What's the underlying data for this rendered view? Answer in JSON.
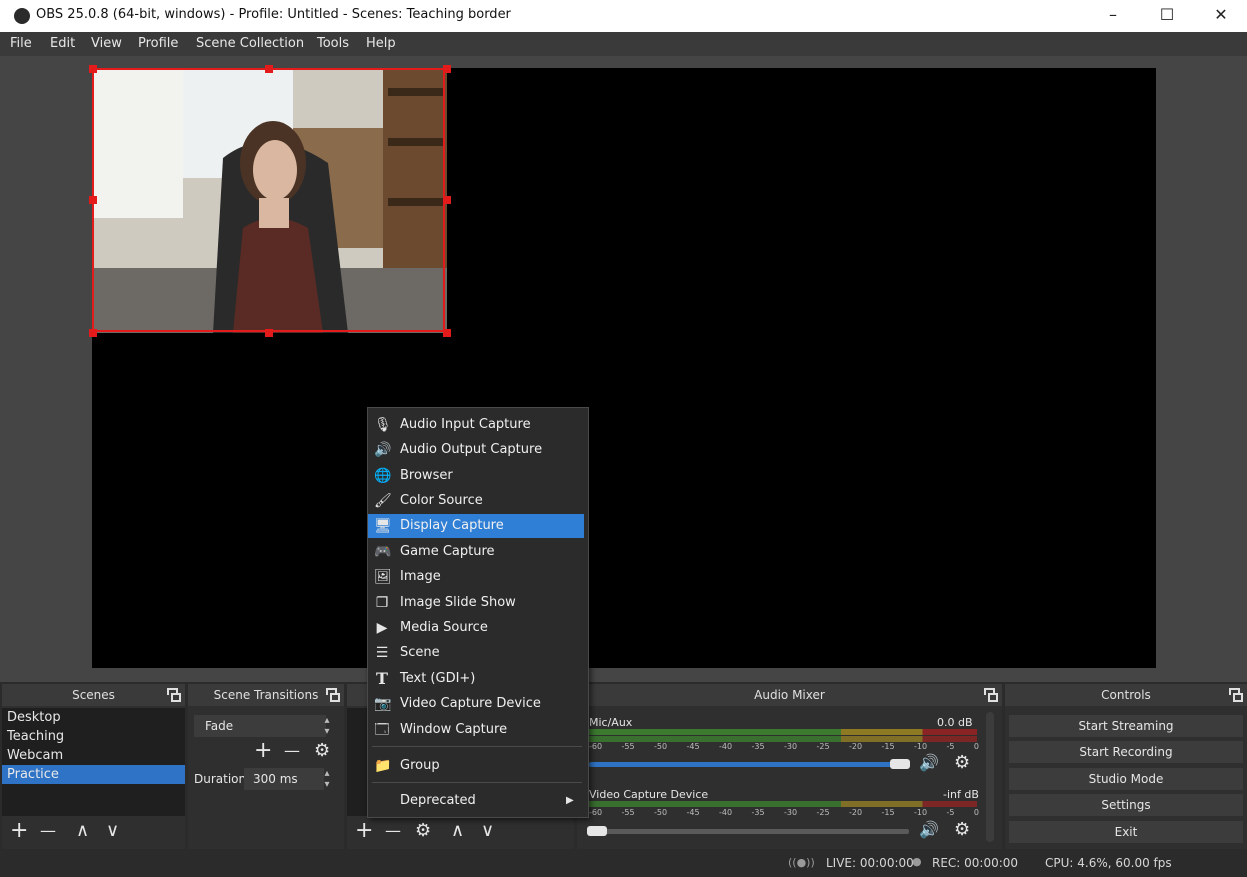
{
  "window": {
    "title": "OBS 25.0.8 (64-bit, windows) - Profile: Untitled - Scenes: Teaching border",
    "minimize": "–",
    "maximize": "☐",
    "close": "✕"
  },
  "menu": [
    "File",
    "Edit",
    "View",
    "Profile",
    "Scene Collection",
    "Tools",
    "Help"
  ],
  "scenes": {
    "title": "Scenes",
    "items": [
      "Desktop",
      "Teaching",
      "Webcam",
      "Practice"
    ],
    "selected": "Practice",
    "buttons": {
      "add": "+",
      "remove": "—",
      "up": "∧",
      "down": "∨"
    }
  },
  "transitions": {
    "title": "Scene Transitions",
    "type": "Fade",
    "duration_label": "Duration",
    "duration_value": "300 ms"
  },
  "sources": {
    "buttons": {
      "add": "+",
      "remove": "—",
      "up": "∧",
      "down": "∨"
    }
  },
  "context_menu": {
    "items": [
      {
        "label": "Audio Input Capture",
        "icon": "microphone-icon"
      },
      {
        "label": "Audio Output Capture",
        "icon": "speaker-icon"
      },
      {
        "label": "Browser",
        "icon": "globe-icon"
      },
      {
        "label": "Color Source",
        "icon": "brush-icon"
      },
      {
        "label": "Display Capture",
        "icon": "monitor-icon",
        "selected": true
      },
      {
        "label": "Game Capture",
        "icon": "gamepad-icon"
      },
      {
        "label": "Image",
        "icon": "image-icon"
      },
      {
        "label": "Image Slide Show",
        "icon": "slideshow-icon"
      },
      {
        "label": "Media Source",
        "icon": "play-icon"
      },
      {
        "label": "Scene",
        "icon": "list-icon"
      },
      {
        "label": "Text (GDI+)",
        "icon": "text-icon"
      },
      {
        "label": "Video Capture Device",
        "icon": "camera-icon"
      },
      {
        "label": "Window Capture",
        "icon": "window-icon"
      }
    ],
    "group": "Group",
    "deprecated": "Deprecated"
  },
  "audio_mixer": {
    "title": "Audio Mixer",
    "ticks": [
      "-60",
      "-55",
      "-50",
      "-45",
      "-40",
      "-35",
      "-30",
      "-25",
      "-20",
      "-15",
      "-10",
      "-5",
      "0"
    ],
    "channels": [
      {
        "name": "Mic/Aux",
        "level": "0.0 dB",
        "volume": 1.0
      },
      {
        "name": "Video Capture Device",
        "level": "-inf dB",
        "volume": 0.0
      }
    ]
  },
  "controls": {
    "title": "Controls",
    "buttons": [
      "Start Streaming",
      "Start Recording",
      "Studio Mode",
      "Settings",
      "Exit"
    ]
  },
  "status": {
    "live": "LIVE: 00:00:00",
    "rec": "REC: 00:00:00",
    "cpu": "CPU: 4.6%, 60.00 fps"
  }
}
